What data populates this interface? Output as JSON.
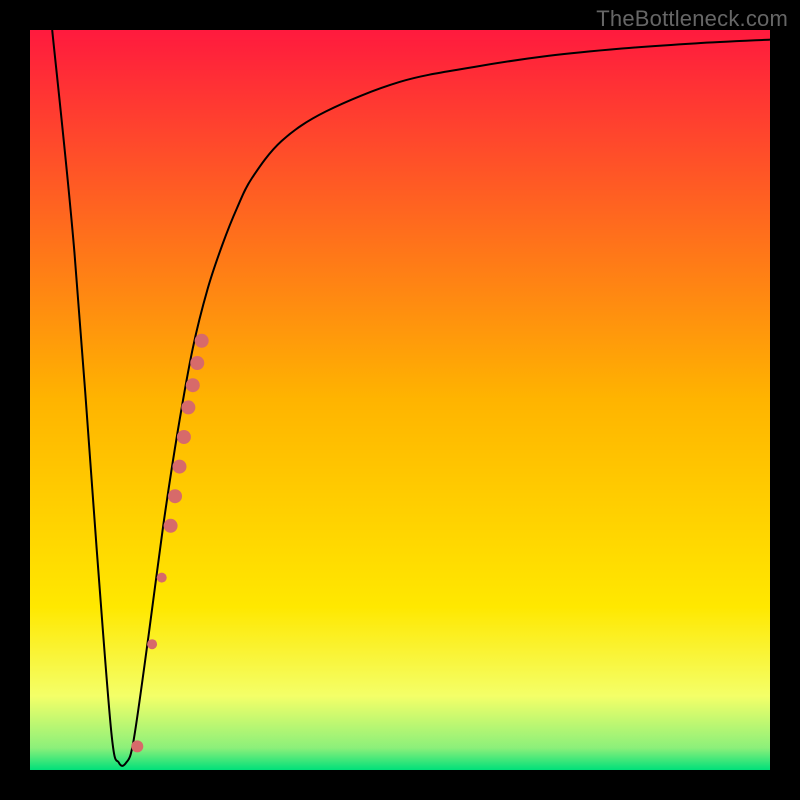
{
  "watermark": "TheBottleneck.com",
  "chart_data": {
    "type": "line",
    "title": "",
    "xlabel": "",
    "ylabel": "",
    "xlim": [
      0,
      100
    ],
    "ylim": [
      0,
      100
    ],
    "grid": false,
    "legend": false,
    "background_gradient": {
      "stops": [
        {
          "pos": 0.0,
          "color": "#ff1a3e"
        },
        {
          "pos": 0.5,
          "color": "#ffb400"
        },
        {
          "pos": 0.78,
          "color": "#ffe800"
        },
        {
          "pos": 0.9,
          "color": "#f4ff68"
        },
        {
          "pos": 0.97,
          "color": "#8cf07a"
        },
        {
          "pos": 1.0,
          "color": "#00e07a"
        }
      ]
    },
    "series": [
      {
        "name": "bottleneck-curve",
        "color": "#000000",
        "stroke_width": 2,
        "x": [
          3,
          6,
          9,
          11,
          12,
          13,
          14,
          16,
          18,
          20,
          22,
          24,
          26,
          28,
          30,
          34,
          40,
          50,
          60,
          70,
          80,
          90,
          100
        ],
        "y": [
          100,
          70,
          30,
          5,
          1,
          1,
          4,
          18,
          33,
          46,
          57,
          65,
          71,
          76,
          80,
          85,
          89,
          93,
          95,
          96.5,
          97.5,
          98.2,
          98.7
        ]
      }
    ],
    "markers": {
      "name": "highlighted-segment",
      "color": "#d76a6a",
      "points": [
        {
          "x": 14.5,
          "y": 3.2,
          "r": 6
        },
        {
          "x": 16.5,
          "y": 17,
          "r": 5
        },
        {
          "x": 17.8,
          "y": 26,
          "r": 5
        },
        {
          "x": 19.0,
          "y": 33,
          "r": 7
        },
        {
          "x": 19.6,
          "y": 37,
          "r": 7
        },
        {
          "x": 20.2,
          "y": 41,
          "r": 7
        },
        {
          "x": 20.8,
          "y": 45,
          "r": 7
        },
        {
          "x": 21.4,
          "y": 49,
          "r": 7
        },
        {
          "x": 22.0,
          "y": 52,
          "r": 7
        },
        {
          "x": 22.6,
          "y": 55,
          "r": 7
        },
        {
          "x": 23.2,
          "y": 58,
          "r": 7
        }
      ]
    }
  }
}
